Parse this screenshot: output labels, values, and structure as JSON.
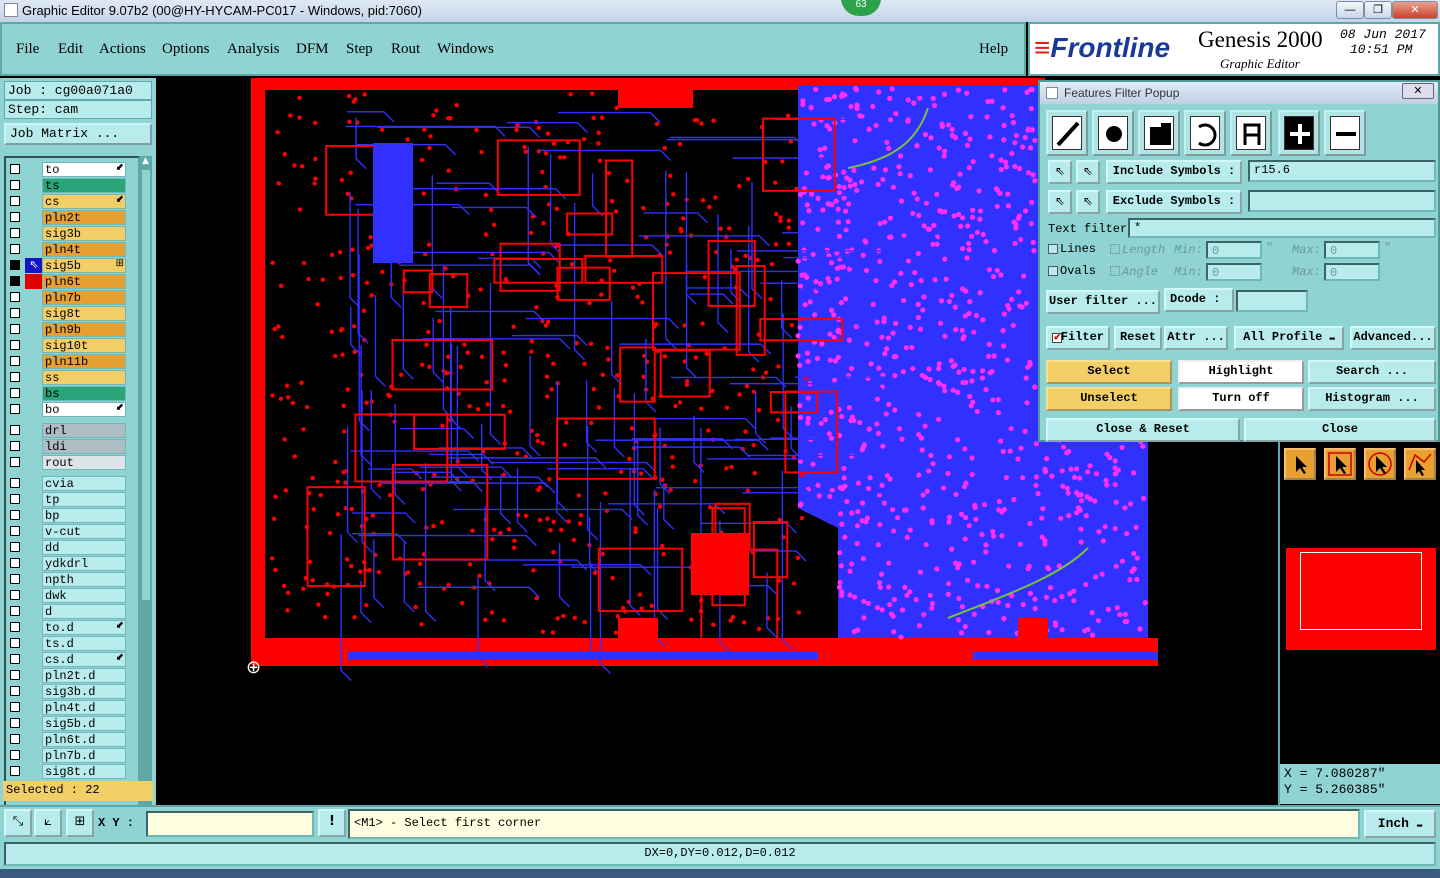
{
  "window": {
    "title": "Graphic Editor 9.07b2 (00@HY-HYCAM-PC017 - Windows, pid:7060)",
    "badge": "63",
    "minimize": "—",
    "maximize": "❐",
    "close": "✕"
  },
  "menu": [
    "File",
    "Edit",
    "Actions",
    "Options",
    "Analysis",
    "DFM",
    "Step",
    "Rout",
    "Windows"
  ],
  "help_label": "Help",
  "brand": {
    "logo": "Frontline",
    "product": "Genesis 2000",
    "subtitle": "Graphic Editor",
    "date": "08 Jun 2017",
    "time": "10:51 PM"
  },
  "job": {
    "job_label": "Job : cg00a071a0",
    "step_label": "Step: cam",
    "matrix_button": "Job Matrix ..."
  },
  "layers": [
    {
      "name": "to",
      "color": "#ffffff",
      "mark": "⬋"
    },
    {
      "name": "ts",
      "color": "#2aa57a",
      "mark": ""
    },
    {
      "name": "cs",
      "color": "#f2ce66",
      "mark": "⬋"
    },
    {
      "name": "pln2t",
      "color": "#e8a030",
      "mark": ""
    },
    {
      "name": "sig3b",
      "color": "#f2ce66",
      "mark": ""
    },
    {
      "name": "pln4t",
      "color": "#e8a030",
      "mark": ""
    },
    {
      "name": "sig5b",
      "color": "#f2ce66",
      "mark": "⊞"
    },
    {
      "name": "pln6t",
      "color": "#e8a030",
      "mark": ""
    },
    {
      "name": "pln7b",
      "color": "#e8a030",
      "mark": ""
    },
    {
      "name": "sig8t",
      "color": "#f2ce66",
      "mark": ""
    },
    {
      "name": "pln9b",
      "color": "#e8a030",
      "mark": ""
    },
    {
      "name": "sig10t",
      "color": "#f2ce66",
      "mark": ""
    },
    {
      "name": "pln11b",
      "color": "#e8a030",
      "mark": ""
    },
    {
      "name": "ss",
      "color": "#f2ce66",
      "mark": ""
    },
    {
      "name": "bs",
      "color": "#2aa57a",
      "mark": ""
    },
    {
      "name": "bo",
      "color": "#ffffff",
      "mark": "⬋"
    }
  ],
  "drill_layers": [
    {
      "name": "drl",
      "color": "#b0bcc4"
    },
    {
      "name": "ldi",
      "color": "#b0bcc4"
    },
    {
      "name": "rout",
      "color": "#dde4e8"
    }
  ],
  "misc_layers": [
    {
      "name": "cvia",
      "mark": ""
    },
    {
      "name": "tp",
      "mark": ""
    },
    {
      "name": "bp",
      "mark": ""
    },
    {
      "name": "v-cut",
      "mark": ""
    },
    {
      "name": "dd",
      "mark": ""
    },
    {
      "name": "ydkdrl",
      "mark": ""
    },
    {
      "name": "npth",
      "mark": ""
    },
    {
      "name": "dwk",
      "mark": ""
    },
    {
      "name": "d",
      "mark": ""
    },
    {
      "name": "to.d",
      "mark": "⬋"
    },
    {
      "name": "ts.d",
      "mark": ""
    },
    {
      "name": "cs.d",
      "mark": "⬋"
    },
    {
      "name": "pln2t.d",
      "mark": ""
    },
    {
      "name": "sig3b.d",
      "mark": ""
    },
    {
      "name": "pln4t.d",
      "mark": ""
    },
    {
      "name": "sig5b.d",
      "mark": ""
    },
    {
      "name": "pln6t.d",
      "mark": ""
    },
    {
      "name": "pln7b.d",
      "mark": ""
    },
    {
      "name": "sig8t.d",
      "mark": ""
    }
  ],
  "selected_label": "Selected : 22",
  "popup": {
    "title": "Features Filter Popup",
    "close": "✕",
    "include_label": "Include Symbols :",
    "include_value": "r15.6",
    "exclude_label": "Exclude Symbols :",
    "exclude_value": "",
    "text_filter_label": "Text filter",
    "text_filter_value": "*",
    "lines_label": "Lines",
    "ovals_label": "Ovals",
    "length_label": "Length",
    "angle_label": "Angle",
    "min_label": "Min:",
    "max_label": "Max:",
    "length_min": "0",
    "length_max": "0",
    "angle_min": "0",
    "angle_max": "0",
    "quote": "\"",
    "user_filter": "User filter ...",
    "dcode_label": "Dcode :",
    "dcode_value": "",
    "filter_label": "Filter",
    "reset": "Reset",
    "attr": "Attr ...",
    "profile": "All Profile",
    "advanced": "Advanced...",
    "select": "Select",
    "highlight": "Highlight",
    "search": "Search ...",
    "unselect": "Unselect",
    "turn_off": "Turn off",
    "histogram": "Histogram ...",
    "close_reset": "Close & Reset",
    "close_btn": "Close"
  },
  "coords": {
    "x": "X = 7.080287\"",
    "y": "Y = 5.260385\""
  },
  "cmd": {
    "xy_label": "X Y :",
    "xy_value": "",
    "warn": "!",
    "prompt": "<M1> - Select first corner",
    "units": "Inch"
  },
  "status": "DX=0,DY=0.012,D=0.012",
  "colors": {
    "panel": "#8fd3d3",
    "copper_red": "#ff0000",
    "trace_blue": "#3030ff",
    "pad_magenta": "#ff30ff",
    "highlight_orange": "#f2ce66"
  }
}
